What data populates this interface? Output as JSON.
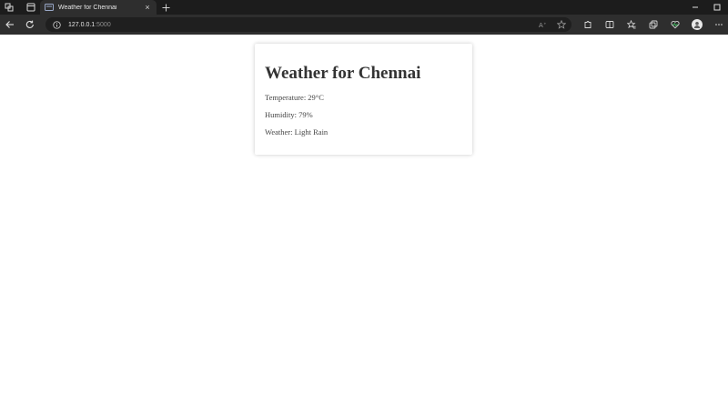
{
  "browser": {
    "tab": {
      "title": "Weather for Chennai"
    },
    "address": {
      "host": "127.0.0.1",
      "port": ":5000"
    }
  },
  "icons": {
    "workspaces": "workspaces-icon",
    "tab_actions": "tab-actions-icon",
    "back": "back-arrow-icon",
    "refresh": "refresh-icon",
    "site_info": "info-icon",
    "read_aloud": "read-aloud-icon",
    "favorite": "star-icon",
    "extensions": "puzzle-icon",
    "split_screen": "split-screen-icon",
    "favorites": "favorites-icon",
    "collections": "collections-icon",
    "browser_essentials": "heart-pulse-icon",
    "profile": "profile-icon",
    "more": "more-icon"
  },
  "colors": {
    "titlebar": "#1c1c1c",
    "toolbar": "#2e2e2e",
    "addressbar": "#1f1f1f",
    "text_dark": "#333333"
  },
  "page": {
    "title": "Weather for Chennai",
    "temperature": "Temperature: 29°C",
    "humidity": "Humidity: 79%",
    "weather": "Weather: Light Rain"
  }
}
